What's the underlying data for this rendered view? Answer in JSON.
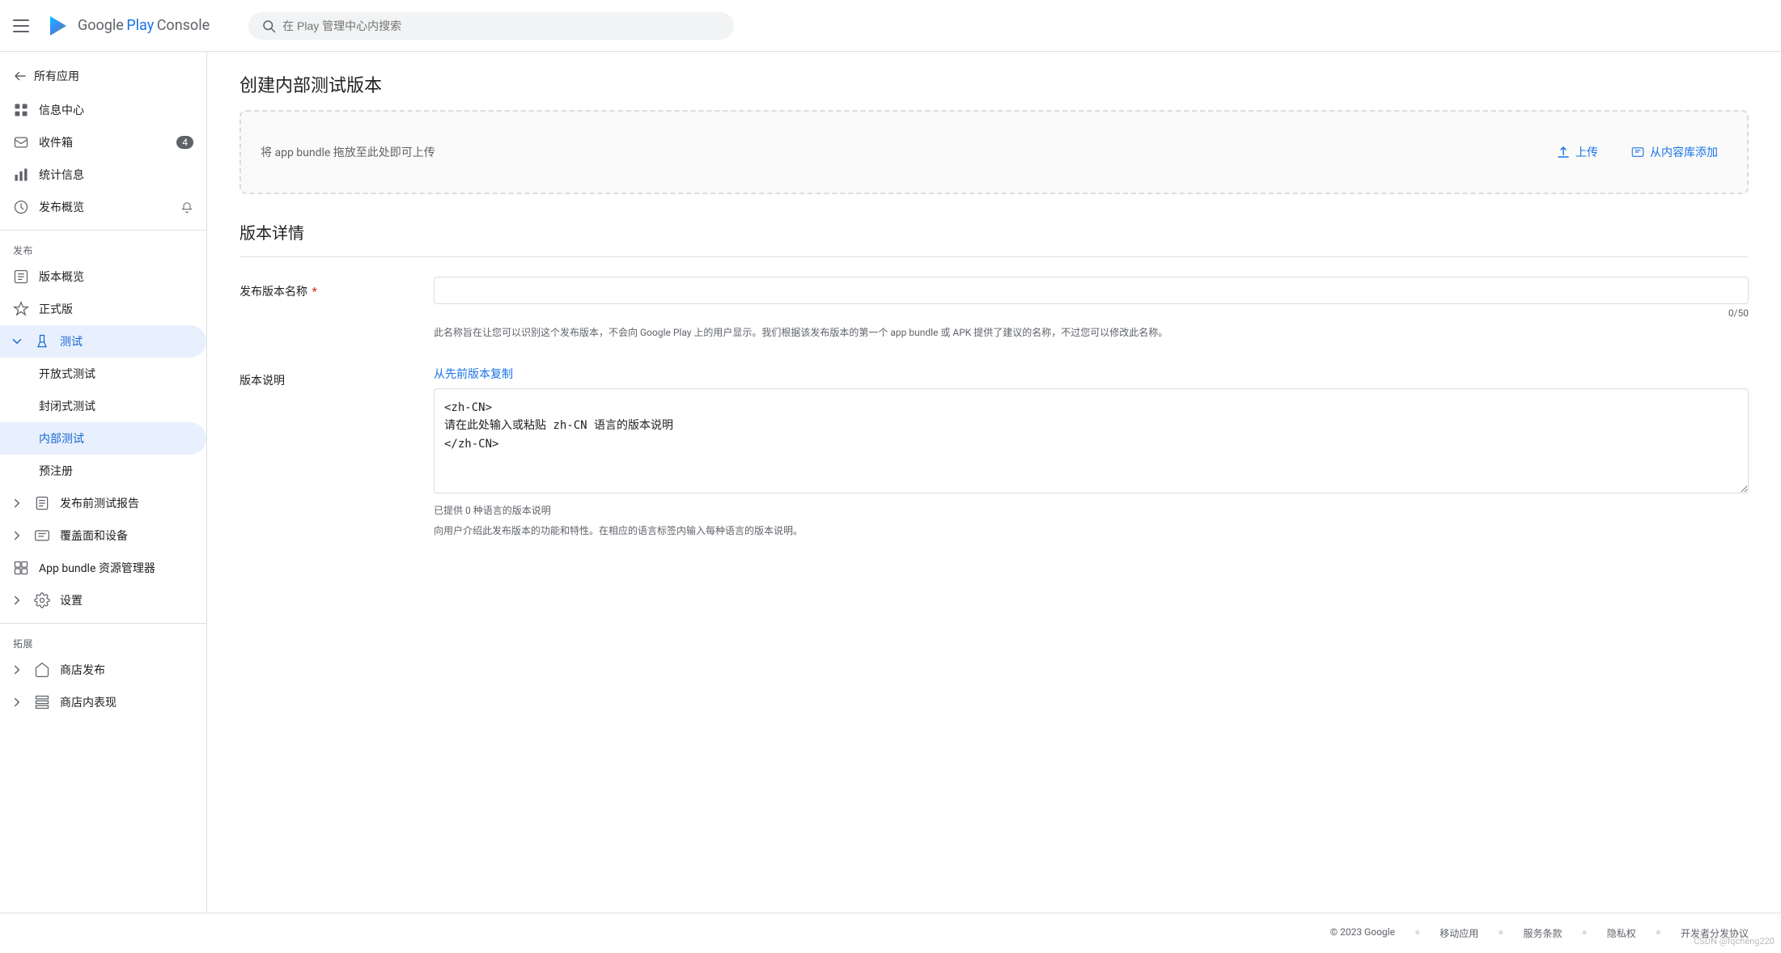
{
  "header": {
    "menu_label": "menu",
    "logo_google": "Google",
    "logo_play": "Play",
    "logo_console": "Console",
    "search_placeholder": "在 Play 管理中心内搜索"
  },
  "sidebar": {
    "back_label": "所有应用",
    "section_publish": "发布",
    "section_expand": "拓展",
    "items": [
      {
        "id": "info-center",
        "label": "信息中心",
        "icon": "dashboard",
        "badge": null
      },
      {
        "id": "inbox",
        "label": "收件箱",
        "icon": "inbox",
        "badge": "4"
      },
      {
        "id": "stats",
        "label": "统计信息",
        "icon": "bar-chart",
        "badge": null
      },
      {
        "id": "publish-overview",
        "label": "发布概览",
        "icon": "publish",
        "badge": null,
        "has_bell": true
      }
    ],
    "publish_items": [
      {
        "id": "version-overview",
        "label": "版本概览",
        "icon": "version"
      },
      {
        "id": "release",
        "label": "正式版",
        "icon": "release"
      },
      {
        "id": "test",
        "label": "测试",
        "icon": "test",
        "active": true,
        "expanded": true
      }
    ],
    "test_sub_items": [
      {
        "id": "open-test",
        "label": "开放式测试"
      },
      {
        "id": "closed-test",
        "label": "封闭式测试"
      },
      {
        "id": "internal-test",
        "label": "内部测试",
        "active": true
      },
      {
        "id": "pre-register",
        "label": "预注册"
      }
    ],
    "more_items": [
      {
        "id": "pre-launch-report",
        "label": "发布前测试报告",
        "expandable": true
      },
      {
        "id": "coverage",
        "label": "覆盖面和设备",
        "expandable": true
      },
      {
        "id": "app-bundle",
        "label": "App bundle 资源管理器"
      },
      {
        "id": "settings",
        "label": "设置",
        "expandable": true
      }
    ],
    "expand_items": [
      {
        "id": "store-publish",
        "label": "商店发布",
        "expandable": true
      },
      {
        "id": "in-store",
        "label": "商店内表现",
        "expandable": true
      }
    ]
  },
  "main": {
    "page_title": "创建内部测试版本",
    "upload_hint": "将 app bundle 拖放至此处即可上传",
    "upload_btn": "上传",
    "upload_from_library": "从内容库添加",
    "section_title": "版本详情",
    "release_name_label": "发布版本名称",
    "release_name_required": "*",
    "release_name_value": "",
    "release_name_char_count": "0/50",
    "release_name_hint": "此名称旨在让您可以识别这个发布版本，不会向 Google Play 上的用户显示。我们根据该发布版本的第一个 app bundle 或 APK 提供了建议的名称，不过您可以修改此名称。",
    "release_notes_label": "版本说明",
    "copy_from_previous": "从先前版本复制",
    "release_notes_content": "<zh-CN>\n请在此处输入或粘贴 zh-CN 语言的版本说明\n</zh-CN>",
    "release_notes_lang_hint": "已提供 0 种语言的版本说明",
    "release_notes_hint": "向用户介绍此发布版本的功能和特性。在相应的语言标签内输入每种语言的版本说明。"
  },
  "footer": {
    "copyright": "© 2023 Google",
    "links": [
      {
        "id": "mobile-app",
        "label": "移动应用"
      },
      {
        "id": "terms",
        "label": "服务条款"
      },
      {
        "id": "privacy",
        "label": "隐私权"
      },
      {
        "id": "dev-agreement",
        "label": "开发者分发协议"
      }
    ]
  },
  "watermark": "CSDN @fqcheng220"
}
